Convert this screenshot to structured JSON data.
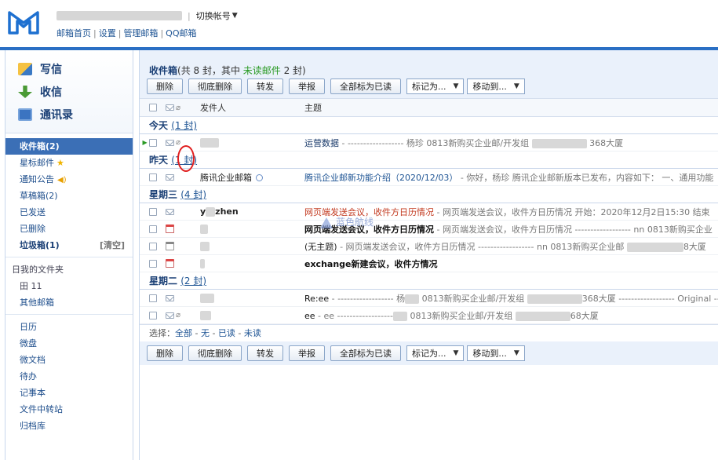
{
  "header": {
    "account_switch": "切换帐号",
    "account_sep": "|",
    "links": [
      "邮箱首页",
      "设置",
      "管理邮箱",
      "QQ邮箱"
    ]
  },
  "left": {
    "compose": "写信",
    "receive": "收信",
    "contacts": "通讯录",
    "folders": [
      {
        "label": "收件箱(2)"
      },
      {
        "label": "星标邮件"
      },
      {
        "label": "通知公告"
      },
      {
        "label": "草稿箱(2)"
      },
      {
        "label": "已发送"
      },
      {
        "label": "已删除"
      },
      {
        "label": "垃圾箱(1)",
        "action": "[清空]"
      }
    ],
    "myfolders": "日我的文件夹",
    "sub_folder": "田 11",
    "other": "其他邮箱",
    "apps": [
      "日历",
      "微盘",
      "微文档",
      "待办",
      "记事本",
      "文件中转站",
      "归档库"
    ]
  },
  "main": {
    "title": "收件箱",
    "summary_a": "(共 8 封，其中 ",
    "unread_label": "未读邮件",
    "summary_b": " 2 封)",
    "toolbar": {
      "delete": "删除",
      "perm_delete": "彻底删除",
      "forward": "转发",
      "report": "举报",
      "mark_all": "全部标为已读",
      "mark_as": "标记为...",
      "move_to": "移动到..."
    },
    "columns": {
      "sender": "发件人",
      "subject": "主题"
    },
    "groups": [
      {
        "name": "今天",
        "count": "(1 封)"
      },
      {
        "name": "昨天",
        "count": "(1 封)"
      },
      {
        "name": "星期三",
        "count": "(4 封)"
      },
      {
        "name": "星期二",
        "count": "(2 封)"
      }
    ],
    "rows": [
      {
        "sender": "",
        "subject": "运营数据",
        "preview": " - ------------------ 杨珍 0813新购买企业邮/开发组",
        "tail": "368大厦"
      },
      {
        "sender": "腾讯企业邮箱",
        "subject": "腾讯企业邮新功能介绍（2020/12/03）",
        "preview": " - 你好，杨珍 腾讯企业邮新版本已发布，内容如下： 一、通用功能"
      },
      {
        "sender": "y",
        "sender2": "zhen",
        "subject": "网页端发送会议，收件方日历情况",
        "preview": " - 网页端发送会议，收件方日历情况 开始：2020年12月2日15:30 结束"
      },
      {
        "sender": "",
        "subject": "网页端发送会议，收件方日历情况",
        "preview": " - 网页端发送会议，收件方日历情况 ------------------ nn 0813新购买企业"
      },
      {
        "sender": "",
        "subject": "(无主题)",
        "preview": " - 网页端发送会议，收件方日历情况 ------------------ nn 0813新购买企业邮",
        "tail": "8大厦"
      },
      {
        "sender": "",
        "subject": "exchange新建会议，收件方情况",
        "preview": ""
      },
      {
        "sender": "",
        "subject": "Re:ee",
        "preview": " - ------------------ 杨",
        "mid": "0813新购买企业邮/开发组",
        "tail": "368大厦 ------------------ Original ---"
      },
      {
        "sender": "",
        "subject": "ee",
        "preview": " - ee ------------------",
        "mid": "0813新购买企业邮/开发组",
        "tail": "68大厦"
      }
    ],
    "select": {
      "label": "选择：",
      "all": "全部",
      "none": "无",
      "read": "已读",
      "unread": "未读",
      "sep": " - "
    },
    "watermark": "蓝色航线"
  },
  "colors": {
    "accent": "#2a6fc4",
    "unread": "#2a9a24",
    "active_folder": "#3b6fb6",
    "highlight": "#e02020"
  }
}
